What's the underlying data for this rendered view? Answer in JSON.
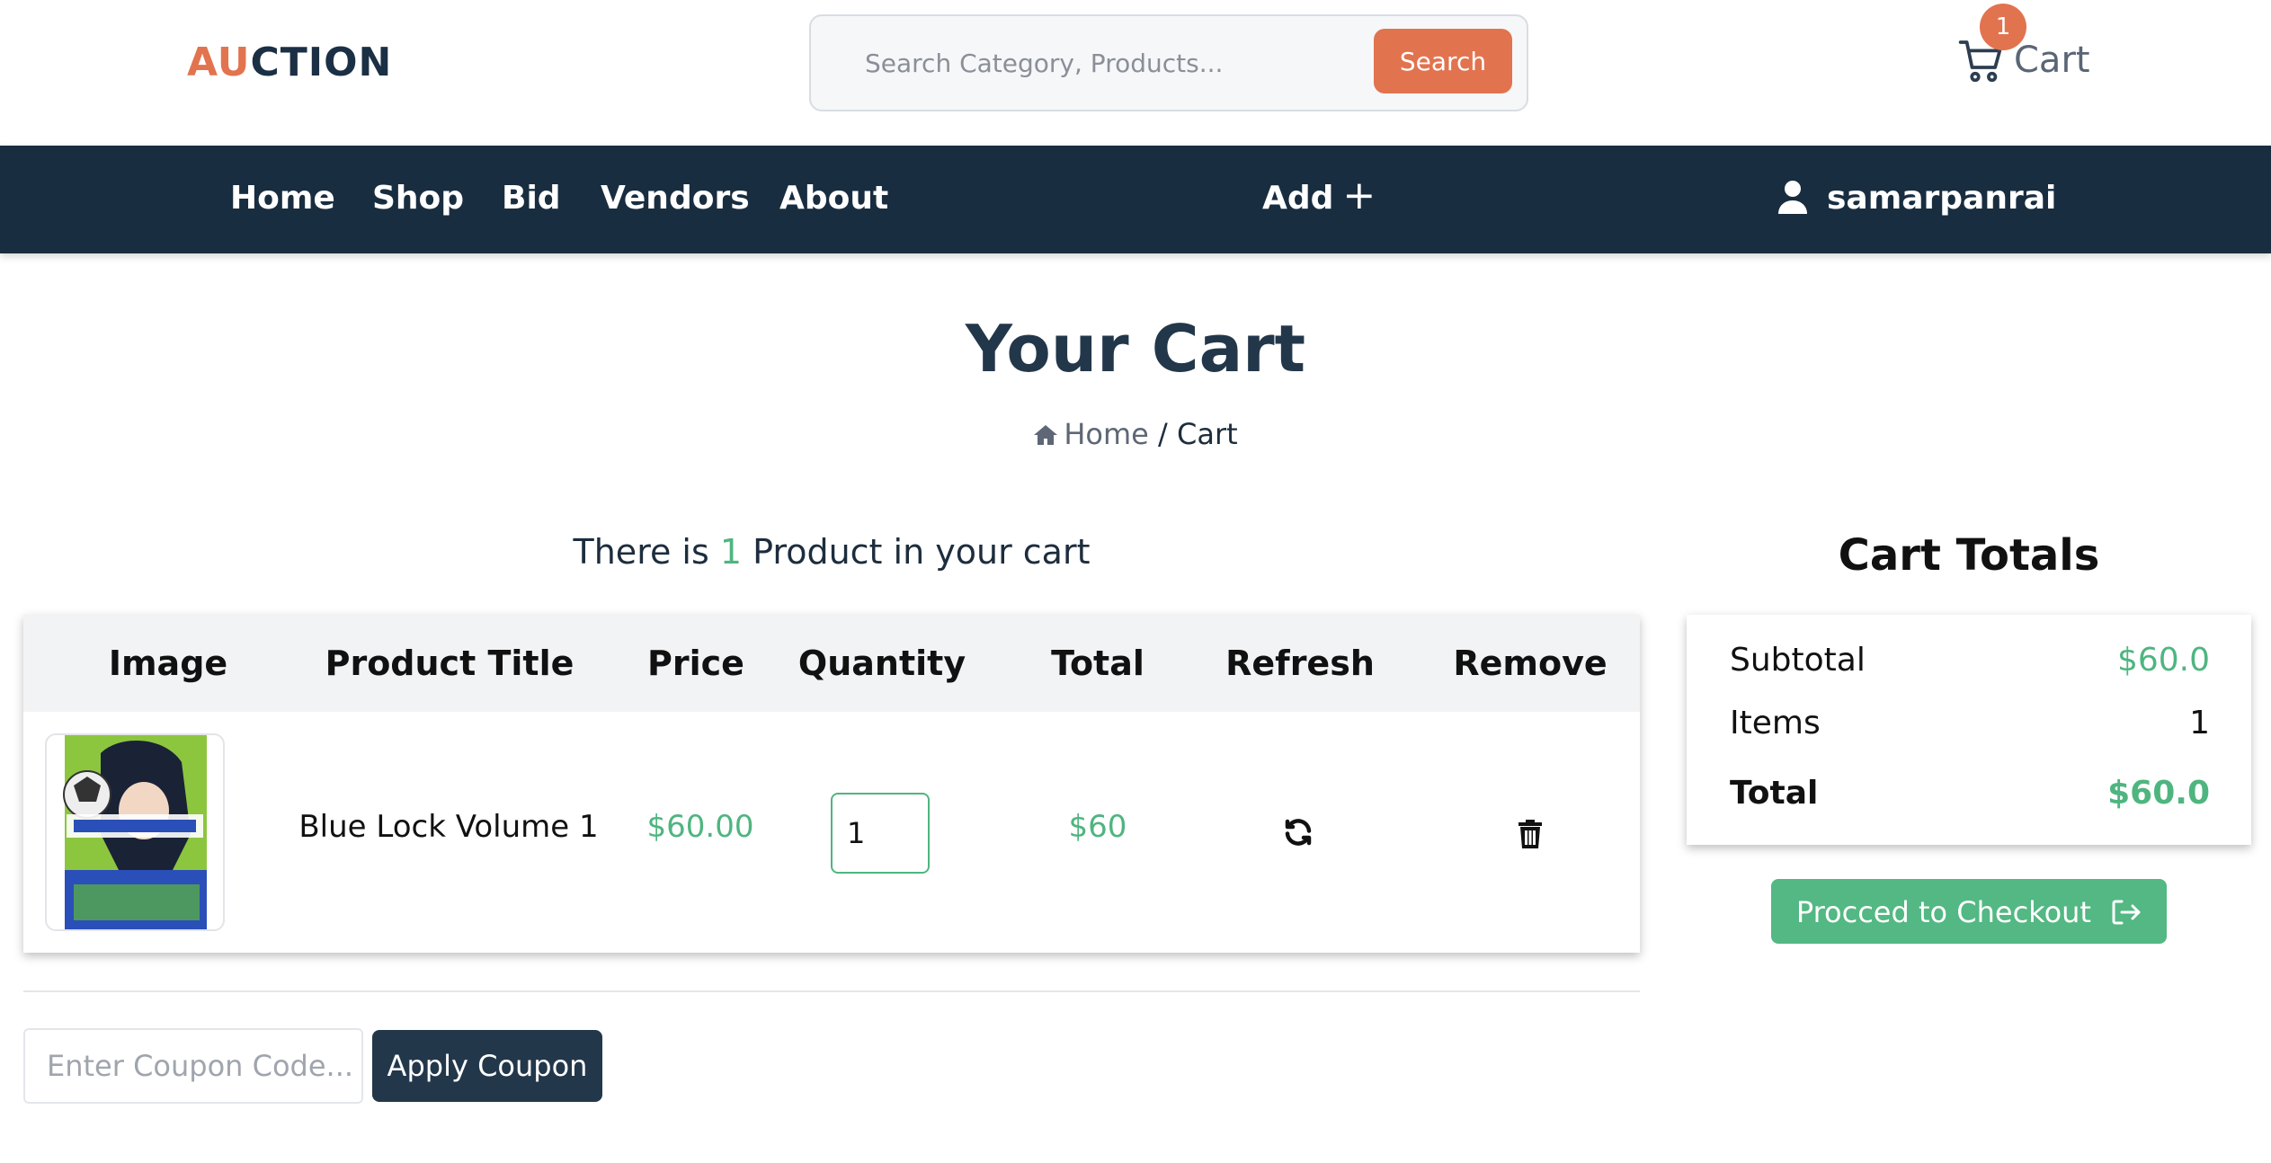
{
  "header": {
    "logo_part1": "AU",
    "logo_part2": "CTION",
    "search_placeholder": "Search Category, Products...",
    "search_button": "Search",
    "cart_label": "Cart",
    "cart_count": "1",
    "accent_color": "#e2734f"
  },
  "nav": {
    "items": [
      "Home",
      "Shop",
      "Bid",
      "Vendors",
      "About"
    ],
    "add_label": "Add",
    "user_name": "samarpanrai",
    "background": "#192d40"
  },
  "page": {
    "title": "Your Cart",
    "breadcrumb_home": "Home",
    "breadcrumb_separator": "/",
    "breadcrumb_current": "Cart"
  },
  "cart": {
    "count_prefix": "There is",
    "count": "1",
    "count_suffix": "Product in your cart",
    "columns": [
      "Image",
      "Product Title",
      "Price",
      "Quantity",
      "Total",
      "Refresh",
      "Remove"
    ],
    "rows": [
      {
        "image_alt": "Blue Lock Volume 1 cover",
        "title": "Blue Lock Volume 1",
        "price": "$60.00",
        "quantity": "1",
        "total": "$60",
        "refresh_icon": "refresh-icon",
        "remove_icon": "trash-icon"
      }
    ],
    "coupon_placeholder": "Enter Coupon Code...",
    "coupon_button": "Apply Coupon"
  },
  "totals": {
    "title": "Cart Totals",
    "subtotal_label": "Subtotal",
    "subtotal_value": "$60.0",
    "items_label": "Items",
    "items_value": "1",
    "total_label": "Total",
    "total_value": "$60.0",
    "checkout_button": "Procced to Checkout",
    "green_color": "#4fb580"
  }
}
